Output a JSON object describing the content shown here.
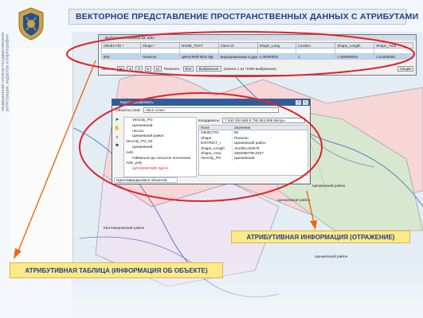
{
  "side_text": "Федеральная служба государственной регистрации, кадастра и картографии",
  "title": "ВЕКТОРНОЕ ПРЕДСТАВЛЕНИЕ ПРОСТРАНСТВЕННЫХ ДАННЫХ С АТРИБУТАМИ",
  "tree_items": [
    "",
    "",
    "",
    "",
    "",
    "",
    "",
    "",
    "",
    "",
    "",
    "",
    "",
    "",
    "",
    "",
    "",
    "",
    "",
    "",
    "",
    "",
    "",
    "",
    "",
    "",
    "",
    "",
    "",
    "",
    "",
    "",
    "",
    "",
    "",
    ""
  ],
  "attr_window": {
    "title": "Выбранные объекты из: adm",
    "columns": [
      "OBJECTID *",
      "Shape *",
      "NAME_TEXT",
      "Class ID",
      "Shape_Leng",
      "location",
      "Shape_Length",
      "Shape_Area"
    ],
    "rows": [
      [
        "",
        "",
        "",
        "",
        "",
        "",
        "",
        ""
      ],
      [
        "604",
        "Полигон",
        "ЦИНСКИЙ ВСЕ ВД",
        "водохранилище и другие водоемы",
        "1.00000002",
        "1",
        "1.000000001",
        "1.51000000"
      ]
    ],
    "record_label": "Записи:",
    "record_value": "0",
    "show_label": "Показать:",
    "all_label": "Все",
    "selected_label": "Выбранные",
    "selected_info": "(записи 1 из *1000 выбранные)",
    "options_label": "Опции"
  },
  "id_window": {
    "title": "Идентифицировать",
    "objects_label": "Объекты слоя:",
    "objects_value": "<Все слои>",
    "tree": [
      "Verocity_PO",
      "Цинаевский",
      "лесхоз",
      "Цинаевский район",
      "Verocity_PO_53",
      "Цинаевский",
      "Adm",
      "Гаймитько-де сельское поселение",
      "Adm_poly",
      "ЦИНАЕВСКИЕ ЗДАН"
    ],
    "coords_label": "Координаты:",
    "coords_value": "7 640 392,899  5 790 924,898 Метры",
    "fields_header": [
      "Поле",
      "Значение"
    ],
    "fields": [
      [
        "OBJECTID",
        "56"
      ],
      [
        "Shape",
        "Полигон"
      ],
      [
        "DISTRICT_I",
        "Цинаевский район"
      ],
      [
        "Shape_Length",
        "311083,420876"
      ],
      [
        "Shape_Area",
        "2584080780,0227"
      ],
      [
        "Verocity_PO",
        "Цинаевский"
      ]
    ],
    "status": "Идентифицировано объектов:"
  },
  "map_labels": {
    "l1": "Цинаевский район",
    "l2": "Кантемировский район",
    "l3": "Цинаевский район",
    "l4": "Цинаевский район"
  },
  "callout_right": "АТРИБУТИВНАЯ ИНФОРМАЦИЯ (ОТРАЖЕНИЕ)",
  "callout_left": "АТРИБУТИВНАЯ ТАБЛИЦА (ИНФОРМАЦИЯ ОБ ОБЪЕКТЕ)",
  "colors": {
    "highlight": "#e0232a",
    "arrow": "#e86a12",
    "title_text": "#1f3f86",
    "callout_bg": "#fde98a"
  }
}
